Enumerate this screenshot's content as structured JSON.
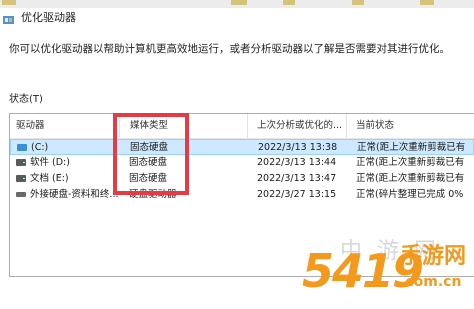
{
  "window": {
    "title": "优化驱动器"
  },
  "description": "你可以优化驱动器以帮助计算机更高效地运行，或者分析驱动器以了解是否需要对其进行优化。",
  "status_label": "状态(T)",
  "table": {
    "columns": [
      "驱动器",
      "媒体类型",
      "上次分析或优化的...",
      "当前状态"
    ],
    "rows": [
      {
        "drive": "(C:)",
        "media": "固态硬盘",
        "last": "2022/3/13 13:38",
        "status": "正常(距上次重新剪裁已有",
        "icon": "system-drive-icon",
        "selected": true
      },
      {
        "drive": "软件 (D:)",
        "media": "固态硬盘",
        "last": "2022/3/13 13:44",
        "status": "正常(距上次重新剪裁已有",
        "icon": "hard-drive-icon",
        "selected": false
      },
      {
        "drive": "文档 (E:)",
        "media": "固态硬盘",
        "last": "2022/3/13 13:47",
        "status": "正常(距上次重新剪裁已有",
        "icon": "hard-drive-icon",
        "selected": false
      },
      {
        "drive": "外接硬盘-资料和终...",
        "media": "硬盘驱动器",
        "last": "2022/3/27 13:15",
        "status": "正常(碎片整理已完成 0%",
        "icon": "external-drive-icon",
        "selected": false
      }
    ]
  },
  "watermark": {
    "big": "5419",
    "site": "手游网",
    "domain": ".com.cn",
    "ghost": "中 游 网"
  },
  "colors": {
    "highlight_box": "#e53b45",
    "selection": "#cde8ff",
    "watermark": "#f39a1e"
  }
}
